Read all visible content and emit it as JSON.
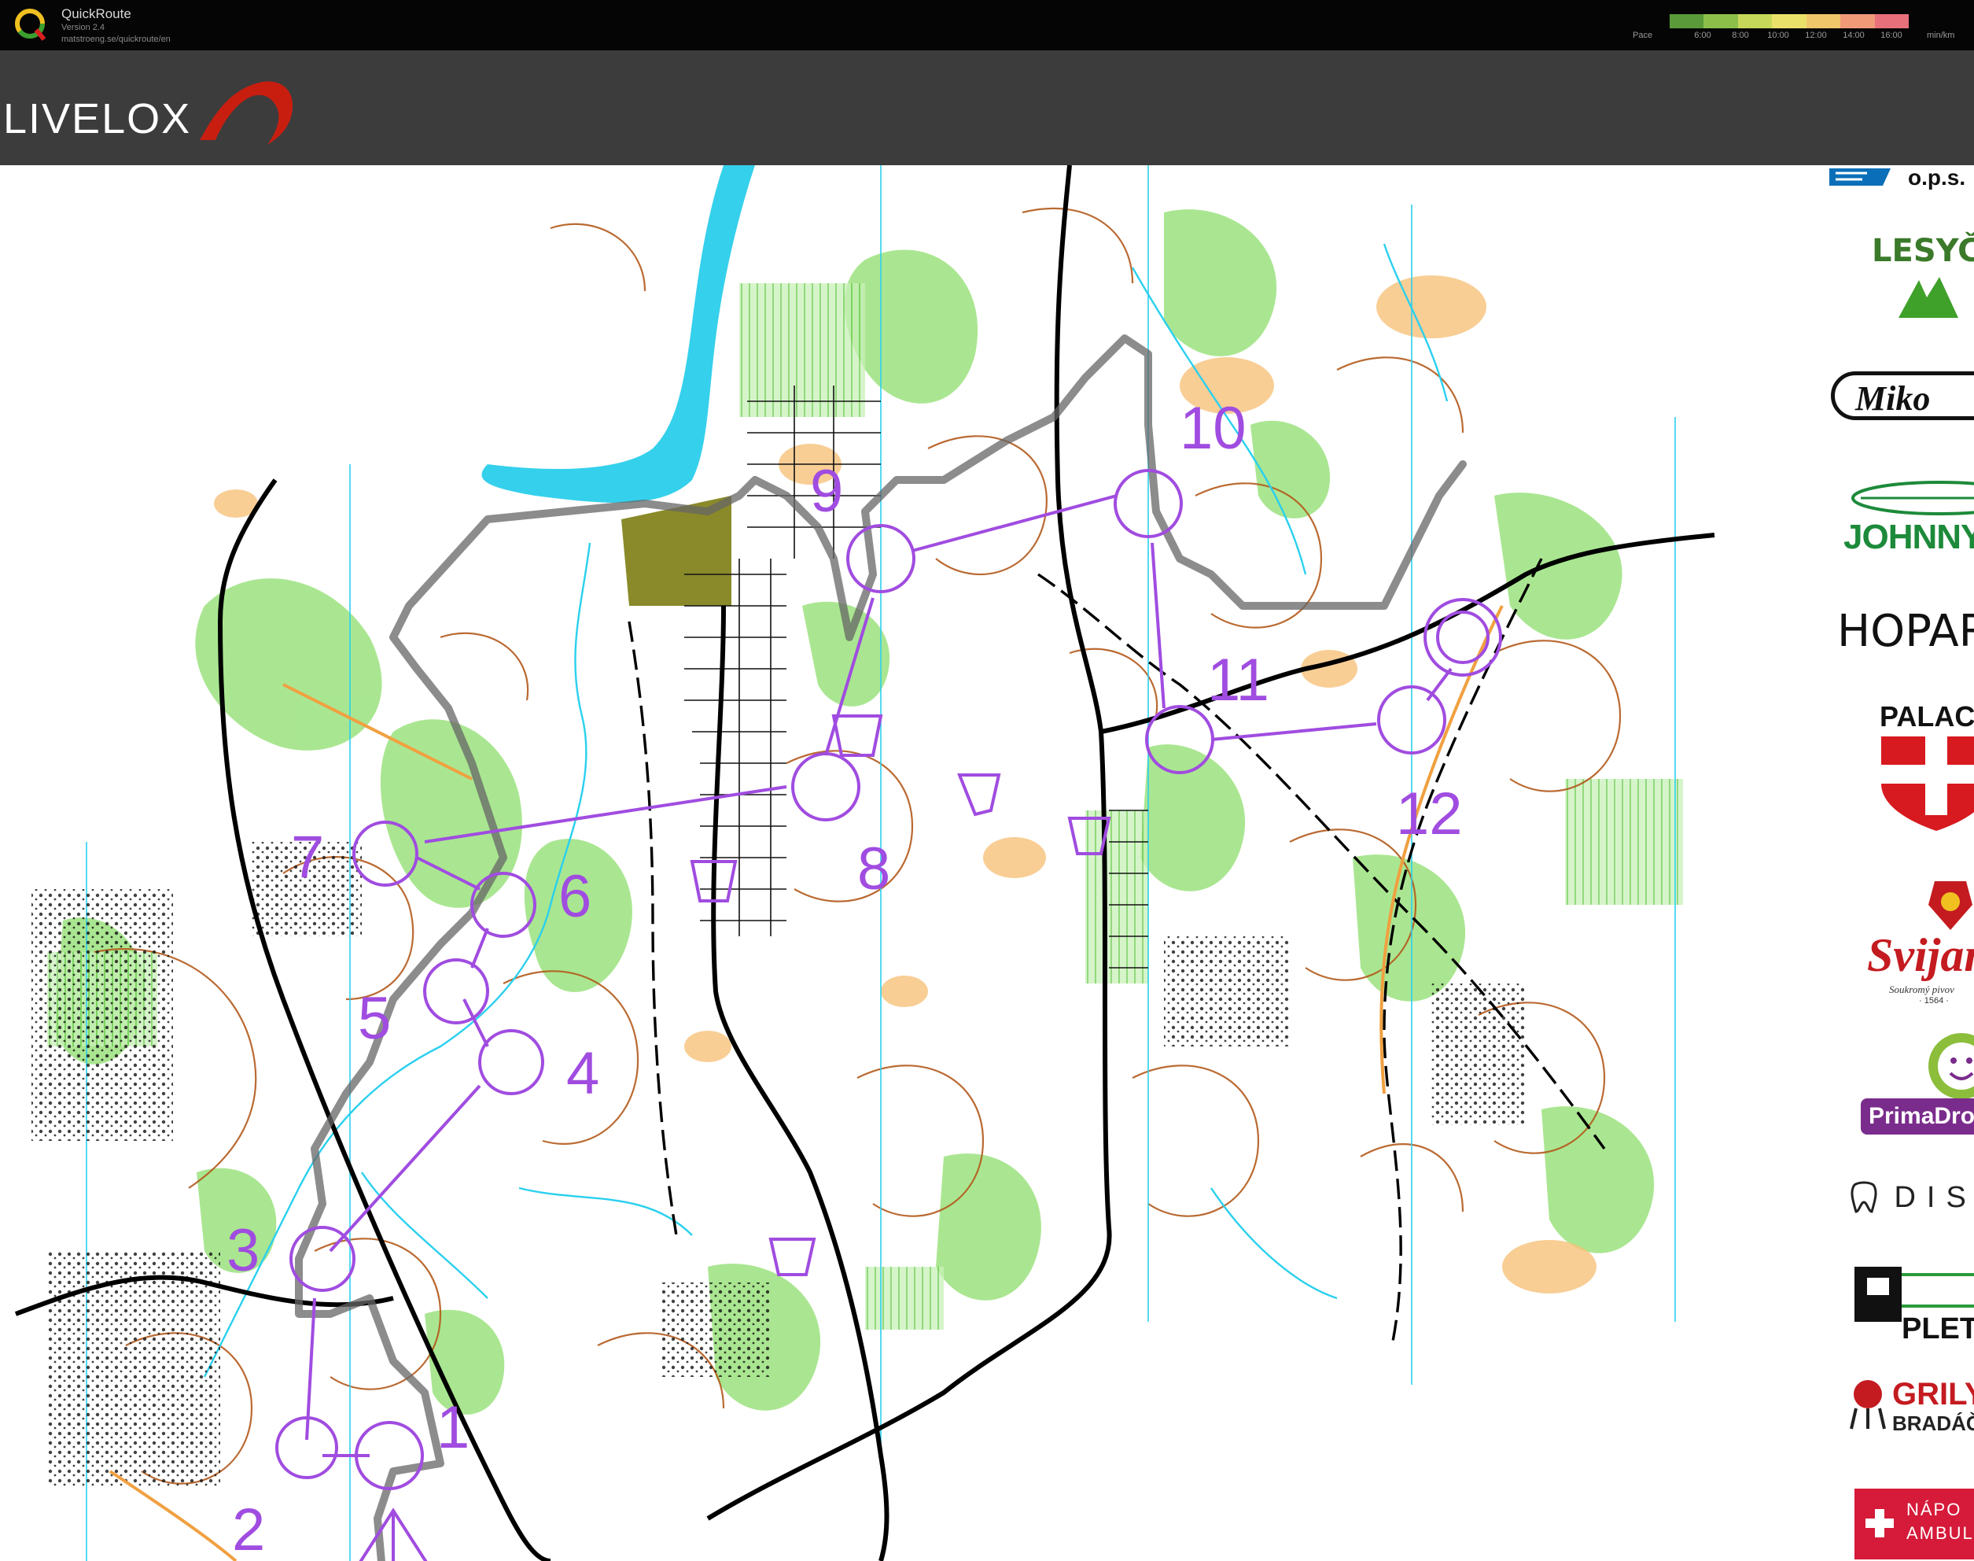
{
  "quickroute": {
    "app_name": "QuickRoute",
    "version": "Version 2.4",
    "url": "matstroeng.se/quickroute/en",
    "pace_label": "Pace",
    "pace_ticks": [
      "6:00",
      "8:00",
      "10:00",
      "12:00",
      "14:00",
      "16:00"
    ],
    "pace_unit": "min/km",
    "pace_colors": [
      "#5a9a3a",
      "#8cbf4a",
      "#c6d85a",
      "#e9e06a",
      "#f0c66a",
      "#f09a78",
      "#e8707a"
    ]
  },
  "livelox": {
    "logo_text": "LIVELOX",
    "accent": "#d42a1a"
  },
  "course": {
    "color": "#a04ce0",
    "controls": [
      "1",
      "2",
      "3",
      "4",
      "5",
      "6",
      "7",
      "8",
      "9",
      "10",
      "11",
      "12"
    ]
  },
  "sponsors": {
    "ops": "o.p.s.",
    "lesy": "LESYČ",
    "miko": "Miko",
    "johnny": "JOHNNY SE",
    "hopar": "HOPAR",
    "palaci": "PALACI",
    "svijany": "Svijan",
    "svijany_sub": "Soukromý pivov",
    "svijany_year": "· 1564 ·",
    "prima": "PrimaDrog",
    "diss": "DISS",
    "pletil": "PLETIL",
    "grily": "GRILY",
    "bradac": "BRADÁČ",
    "ambul1": "NÁPO",
    "ambul2": "AMBUL"
  }
}
